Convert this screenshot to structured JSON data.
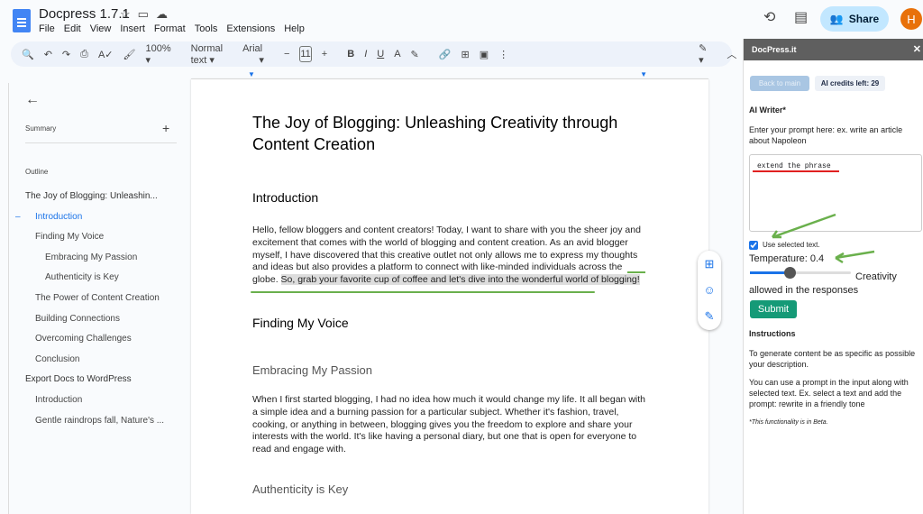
{
  "app": {
    "title": "Docpress 1.7.1",
    "menu": [
      "File",
      "Edit",
      "View",
      "Insert",
      "Format",
      "Tools",
      "Extensions",
      "Help"
    ],
    "share_label": "Share",
    "avatar_initial": "H"
  },
  "toolbar": {
    "zoom": "100%",
    "style": "Normal text",
    "font": "Arial",
    "font_size": "11"
  },
  "outline": {
    "summary_label": "Summary",
    "outline_label": "Outline",
    "items": [
      {
        "label": "The Joy of Blogging: Unleashin...",
        "level": 0
      },
      {
        "label": "Introduction",
        "level": 1,
        "active": true
      },
      {
        "label": "Finding My Voice",
        "level": 1
      },
      {
        "label": "Embracing My Passion",
        "level": 2
      },
      {
        "label": "Authenticity is Key",
        "level": 2
      },
      {
        "label": "The Power of Content Creation",
        "level": 1
      },
      {
        "label": "Building Connections",
        "level": 1
      },
      {
        "label": "Overcoming Challenges",
        "level": 1
      },
      {
        "label": "Conclusion",
        "level": 1
      },
      {
        "label": "Export Docs to WordPress",
        "level": 0
      },
      {
        "label": "Introduction",
        "level": 1
      },
      {
        "label": "Gentle raindrops fall, Nature's ...",
        "level": 1
      }
    ]
  },
  "doc": {
    "title": "The Joy of Blogging: Unleashing Creativity through Content Creation",
    "h_intro": "Introduction",
    "p_intro": "Hello, fellow bloggers and content creators! Today, I want to share with you the sheer joy and excitement that comes with the world of blogging and content creation. As an avid blogger myself, I have discovered that this creative outlet not only allows me to express my thoughts and ideas but also provides a platform to connect with like-minded individuals across the globe. ",
    "p_intro_selected": "So, grab your favorite cup of coffee and let's dive into the wonderful world of blogging!",
    "h_voice": "Finding My Voice",
    "h_passion": "Embracing My Passion",
    "p_passion": "When I first started blogging, I had no idea how much it would change my life. It all began with a simple idea and a burning passion for a particular subject. Whether it's fashion, travel, cooking, or anything in between, blogging gives you the freedom to explore and share your interests with the world. It's like having a personal diary, but one that is open for everyone to read and engage with.",
    "h_auth": "Authenticity is Key"
  },
  "panel": {
    "title": "DocPress.it",
    "back_label": "Back to main",
    "credits": "AI credits left: 29",
    "section": "AI Writer*",
    "prompt_hint": "Enter your prompt here: ex. write an article about Napoleon",
    "prompt_value": "extend the phrase",
    "use_selected_label": "Use selected text.",
    "use_selected": true,
    "temperature_label": "Temperature: 0.4",
    "temperature": 0.4,
    "creativity_label": "Creativity allowed in the responses",
    "submit_label": "Submit",
    "instructions_title": "Instructions",
    "instr1": "To generate content be as specific as possible your description.",
    "instr2": "You can use a prompt in the input along with selected text. Ex. select a text and add the prompt: rewrite in a friendly tone",
    "beta_note": "*This functionality is in Beta."
  },
  "colors": {
    "accent": "#1a73e8",
    "share_bg": "#c2e7ff",
    "submit": "#159a77",
    "annotation_green": "#6ab04c",
    "annotation_red": "#e02020"
  }
}
